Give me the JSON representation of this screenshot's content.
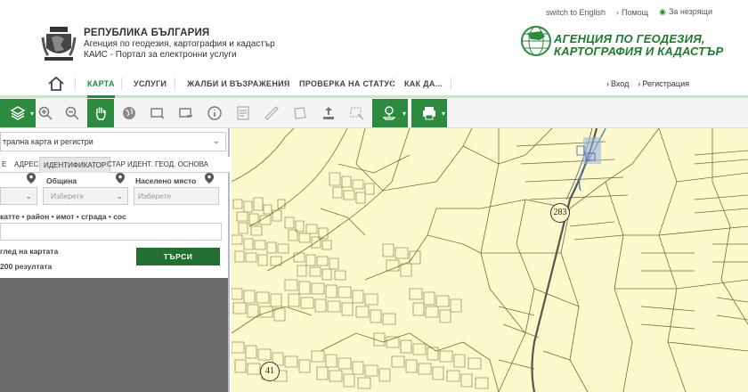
{
  "top_links": {
    "english": "switch to English",
    "help": "Помощ",
    "forgot": "За незрящи"
  },
  "brand": {
    "line1": "РЕПУБЛИКА БЪЛГАРИЯ",
    "line2": "Агенция по геодезия, картография и кадастър",
    "line3": "КАИС - Портал за електронни услуги"
  },
  "agency_logo": {
    "line1": "АГЕНЦИЯ ПО ГЕОДЕЗИЯ,",
    "line2": "КАРТОГРАФИЯ И КАДАСТЪР"
  },
  "nav": {
    "items": [
      "КАРТА",
      "УСЛУГИ",
      "ЖАЛБИ И ВЪЗРАЖЕНИЯ",
      "ПРОВЕРКА НА СТАТУС",
      "КАК ДА..."
    ],
    "login": "Вход",
    "register": "Регистрация"
  },
  "panel": {
    "layer_select": "трална карта и регистри",
    "tabs": [
      "Е",
      "АДРЕС",
      "ИДЕНТИФИКАТОР",
      "СТАР ИДЕНТ.",
      "ГЕОД. ОСНОВА"
    ],
    "municipality_label": "Община",
    "settlement_label": "Населено място",
    "municipality_placeholder": "Изберете",
    "settlement_placeholder": "Изберете",
    "identifier_hint": "катте • район • имот • сграда • сос",
    "view_on_map": "глед на картата",
    "results_limit": "200 резултата",
    "search_button": "ТЪРСИ"
  },
  "map": {
    "badges": [
      "283",
      "41"
    ]
  },
  "colors": {
    "accent": "#2d8a3e",
    "map_bg": "#fcf9cc",
    "parcel_line": "#7a6a3a"
  }
}
